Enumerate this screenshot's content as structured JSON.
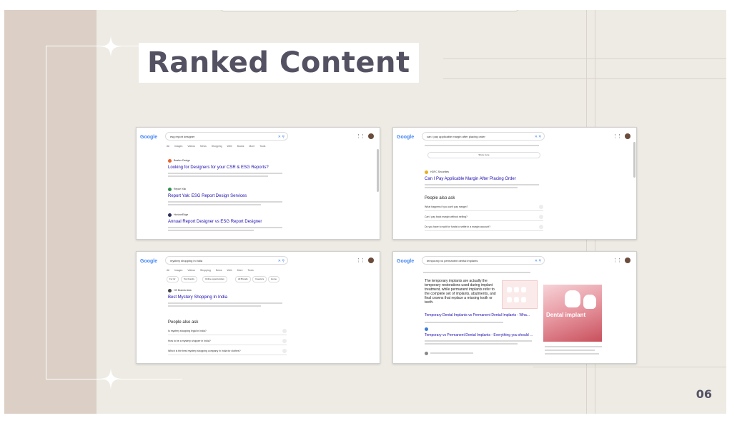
{
  "slide": {
    "title": "Ranked Content",
    "page_number": "06"
  },
  "colors": {
    "background": "#eeebe4",
    "left_band": "#dccfc6",
    "title_text": "#545262",
    "title_highlight": "#ffffff"
  },
  "icons": [
    "sparkle-icon",
    "google-logo-icon",
    "mic-icon",
    "lens-icon",
    "search-icon",
    "apps-grid-icon",
    "avatar-icon"
  ],
  "screenshots": [
    {
      "logo": "Google",
      "query": "esg report designer",
      "tabs": [
        "All",
        "Images",
        "Videos",
        "News",
        "Shopping",
        "Web",
        "Books",
        "More",
        "Tools"
      ],
      "results": [
        {
          "site": "Beaker Design",
          "title": "Looking for Designers for your CSR & ESG Reports?"
        },
        {
          "site": "Report Yak",
          "title": "Report Yak: ESG Report Design Services"
        },
        {
          "site": "HorizonEdge",
          "title": "Annual Report Designer vs ESG Report Designer"
        }
      ]
    },
    {
      "logo": "Google",
      "query": "can i pay applicable margin after placing order",
      "show_more": "Show more",
      "result": {
        "site": "HDFC Securities",
        "title": "Can I Pay Applicable Margin After Placing Order"
      },
      "paa_title": "People also ask",
      "paa": [
        "What happens if you can't pay margin?",
        "Can I pay back margin without selling?",
        "Do you have to wait for funds to settle in a margin account?"
      ]
    },
    {
      "logo": "Google",
      "query": "mystery shopping in india",
      "chips": [
        "For Hr",
        "Top brands",
        "Online opportunities",
        "All Brands",
        "Investors",
        "Home"
      ],
      "result": {
        "site": "HS Brands Asia",
        "title": "Best Mystery Shopping In India"
      },
      "paa_title": "People also ask",
      "paa": [
        "Is mystery shopping legal in India?",
        "How to be a mystery shopper in India?",
        "Which is the best mystery shopping company in India for clothes?"
      ]
    },
    {
      "logo": "Google",
      "query": "temporary vs permanent dental implants",
      "snippet": "The temporary implants are actually the temporary restorations used during implant treatment, while permanent implants refer to the complete set of implants, abutments, and final crowns that replace a missing tooth or teeth.",
      "result1": "Temporary Dental Implants vs Permanent Dental Implants - Wha...",
      "result2": "Temporary vs Permanent Dental Implants - Everything you should ...",
      "panel_label": "Dental implant"
    }
  ]
}
